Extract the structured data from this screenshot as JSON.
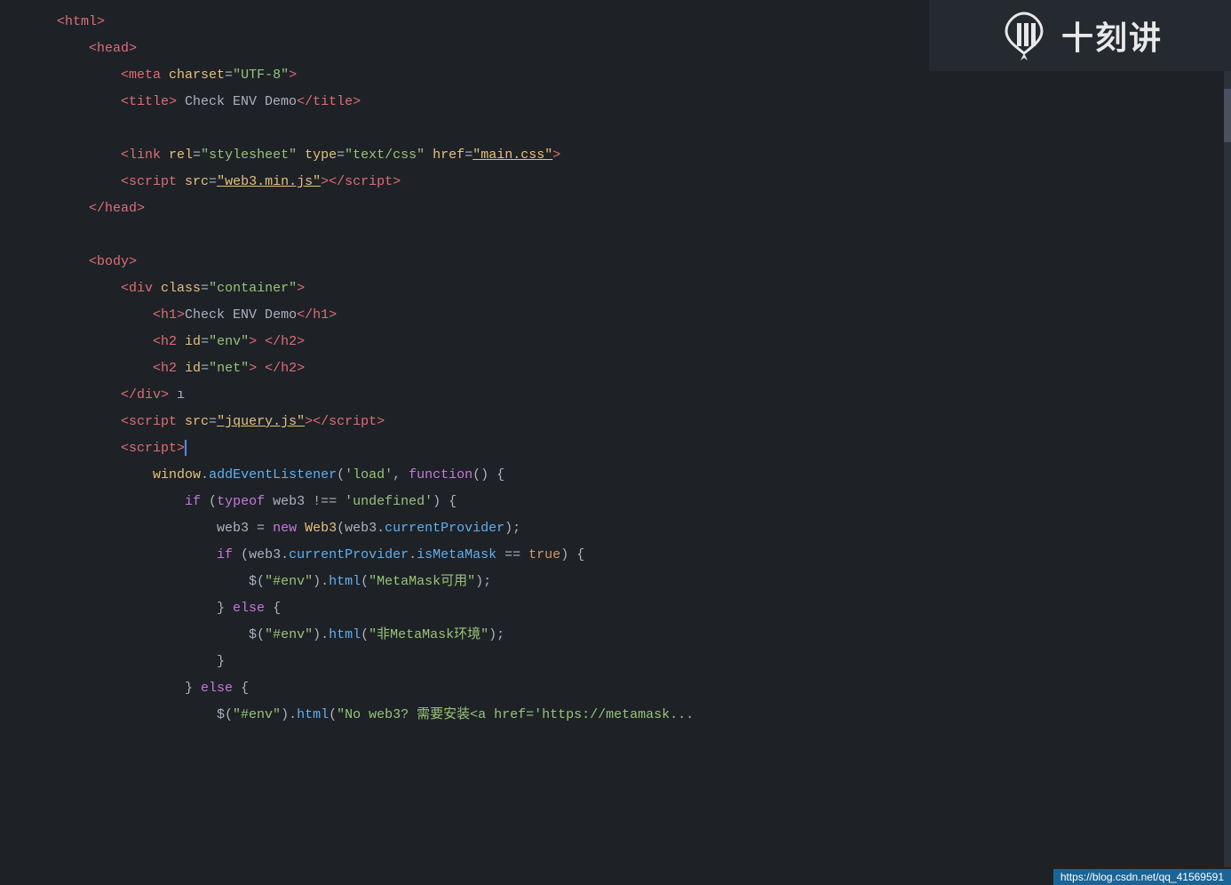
{
  "watermark": {
    "icon_label": "logo-icon",
    "text": "十刻讲"
  },
  "bottom_bar": {
    "url": "https://blog.csdn.net/qq_41569591"
  },
  "lines": [
    {
      "dots": "",
      "indent": 0,
      "parts": [
        {
          "type": "tag",
          "text": "<html>"
        }
      ]
    },
    {
      "dots": "·",
      "indent": 1,
      "parts": [
        {
          "type": "tag",
          "text": "<head>"
        }
      ]
    },
    {
      "dots": "· · ·",
      "indent": 2,
      "parts": [
        {
          "type": "tag",
          "text": "<meta "
        },
        {
          "type": "attr-name",
          "text": "charset"
        },
        {
          "type": "punctuation",
          "text": "="
        },
        {
          "type": "attr-value",
          "text": "\"UTF-8\""
        },
        {
          "type": "tag",
          "text": ">"
        }
      ]
    },
    {
      "dots": "· · ·",
      "indent": 2,
      "parts": [
        {
          "type": "tag",
          "text": "<title>"
        },
        {
          "type": "text-content",
          "text": " Check ENV Demo"
        },
        {
          "type": "tag",
          "text": "</title>"
        }
      ]
    },
    {
      "dots": "",
      "indent": 0,
      "parts": []
    },
    {
      "dots": "· · ·",
      "indent": 2,
      "parts": [
        {
          "type": "tag",
          "text": "<link "
        },
        {
          "type": "attr-name",
          "text": "rel"
        },
        {
          "type": "punctuation",
          "text": "="
        },
        {
          "type": "attr-value",
          "text": "\"stylesheet\""
        },
        {
          "type": "text-content",
          "text": " "
        },
        {
          "type": "attr-name",
          "text": "type"
        },
        {
          "type": "punctuation",
          "text": "="
        },
        {
          "type": "attr-value",
          "text": "\"text/css\""
        },
        {
          "type": "text-content",
          "text": " "
        },
        {
          "type": "attr-name",
          "text": "href"
        },
        {
          "type": "punctuation",
          "text": "="
        },
        {
          "type": "attr-value-link",
          "text": "\"main.css\""
        },
        {
          "type": "tag",
          "text": ">"
        }
      ]
    },
    {
      "dots": "· · ·",
      "indent": 2,
      "parts": [
        {
          "type": "tag",
          "text": "<script "
        },
        {
          "type": "attr-name",
          "text": "src"
        },
        {
          "type": "punctuation",
          "text": "="
        },
        {
          "type": "attr-value-link",
          "text": "\"web3.min.js\""
        },
        {
          "type": "tag",
          "text": "></"
        },
        {
          "type": "tag",
          "text": "script>"
        }
      ]
    },
    {
      "dots": "·",
      "indent": 1,
      "parts": [
        {
          "type": "tag",
          "text": "</head>"
        }
      ]
    },
    {
      "dots": "",
      "indent": 0,
      "parts": []
    },
    {
      "dots": "·",
      "indent": 1,
      "parts": [
        {
          "type": "tag",
          "text": "<body>"
        }
      ]
    },
    {
      "dots": "· · · ·",
      "indent": 2,
      "parts": [
        {
          "type": "tag",
          "text": "<div "
        },
        {
          "type": "attr-name",
          "text": "class"
        },
        {
          "type": "punctuation",
          "text": "="
        },
        {
          "type": "attr-value",
          "text": "\"container\""
        },
        {
          "type": "tag",
          "text": ">"
        }
      ]
    },
    {
      "dots": "· · · · · · ·",
      "indent": 3,
      "parts": [
        {
          "type": "tag",
          "text": "<h1>"
        },
        {
          "type": "text-content",
          "text": "Check ENV Demo"
        },
        {
          "type": "tag",
          "text": "</h1>"
        }
      ]
    },
    {
      "dots": "· · · · · · ·",
      "indent": 3,
      "parts": [
        {
          "type": "tag",
          "text": "<h2 "
        },
        {
          "type": "attr-name",
          "text": "id"
        },
        {
          "type": "punctuation",
          "text": "="
        },
        {
          "type": "attr-value",
          "text": "\"env\""
        },
        {
          "type": "tag",
          "text": "> "
        },
        {
          "type": "tag",
          "text": "</h2>"
        }
      ]
    },
    {
      "dots": "· · · · · · ·",
      "indent": 3,
      "parts": [
        {
          "type": "tag",
          "text": "<h2 "
        },
        {
          "type": "attr-name",
          "text": "id"
        },
        {
          "type": "punctuation",
          "text": "="
        },
        {
          "type": "attr-value",
          "text": "\"net\""
        },
        {
          "type": "tag",
          "text": "> "
        },
        {
          "type": "tag",
          "text": "</h2>"
        }
      ]
    },
    {
      "dots": "· · · ·",
      "indent": 2,
      "parts": [
        {
          "type": "tag",
          "text": "</div>"
        },
        {
          "type": "text-content",
          "text": " ı"
        }
      ]
    },
    {
      "dots": "· · · ·",
      "indent": 2,
      "parts": [
        {
          "type": "tag",
          "text": "<script "
        },
        {
          "type": "attr-name",
          "text": "src"
        },
        {
          "type": "punctuation",
          "text": "="
        },
        {
          "type": "attr-value-link",
          "text": "\"jquery.js\""
        },
        {
          "type": "tag",
          "text": "></"
        },
        {
          "type": "tag",
          "text": "script>"
        }
      ]
    },
    {
      "dots": "· · · ·",
      "indent": 2,
      "parts": [
        {
          "type": "tag",
          "text": "<script>"
        },
        {
          "type": "cursor",
          "text": ""
        }
      ]
    },
    {
      "dots": "· · · · · · · ·",
      "indent": 3,
      "parts": [
        {
          "type": "js-obj",
          "text": "window"
        },
        {
          "type": "punctuation",
          "text": "."
        },
        {
          "type": "js-prop",
          "text": "addEventListener"
        },
        {
          "type": "punctuation",
          "text": "("
        },
        {
          "type": "string",
          "text": "'load'"
        },
        {
          "type": "punctuation",
          "text": ", "
        },
        {
          "type": "keyword",
          "text": "function"
        },
        {
          "type": "punctuation",
          "text": "() {"
        }
      ]
    },
    {
      "dots": "· · · · · · · · · · · ·",
      "indent": 4,
      "parts": [
        {
          "type": "keyword",
          "text": "if"
        },
        {
          "type": "punctuation",
          "text": " ("
        },
        {
          "type": "keyword",
          "text": "typeof"
        },
        {
          "type": "js-text",
          "text": " web3 "
        },
        {
          "type": "punctuation",
          "text": "!== "
        },
        {
          "type": "string",
          "text": "'undefined'"
        },
        {
          "type": "punctuation",
          "text": ") {"
        }
      ]
    },
    {
      "dots": "· · · · · · · · · · · · · · · ·",
      "indent": 5,
      "parts": [
        {
          "type": "js-text",
          "text": "web3 "
        },
        {
          "type": "equals",
          "text": "= "
        },
        {
          "type": "keyword",
          "text": "new "
        },
        {
          "type": "js-obj",
          "text": "Web3"
        },
        {
          "type": "punctuation",
          "text": "("
        },
        {
          "type": "js-text",
          "text": "web3"
        },
        {
          "type": "punctuation",
          "text": "."
        },
        {
          "type": "js-prop",
          "text": "currentProvider"
        },
        {
          "type": "punctuation",
          "text": ");"
        }
      ]
    },
    {
      "dots": "· · · · · · · · · · · ·",
      "indent": 5,
      "parts": [
        {
          "type": "keyword",
          "text": "if"
        },
        {
          "type": "punctuation",
          "text": " ("
        },
        {
          "type": "js-text",
          "text": "web3"
        },
        {
          "type": "punctuation",
          "text": "."
        },
        {
          "type": "js-prop",
          "text": "currentProvider"
        },
        {
          "type": "punctuation",
          "text": "."
        },
        {
          "type": "js-prop",
          "text": "isMetaMask"
        },
        {
          "type": "punctuation",
          "text": " == "
        },
        {
          "type": "js-bool",
          "text": "true"
        },
        {
          "type": "punctuation",
          "text": ") {"
        }
      ]
    },
    {
      "dots": "· · · · · · · · · · · · · · · ·",
      "indent": 6,
      "parts": [
        {
          "type": "js-text",
          "text": "$("
        },
        {
          "type": "string",
          "text": "\"#env\""
        },
        {
          "type": "js-text",
          "text": ")."
        },
        {
          "type": "js-prop",
          "text": "html"
        },
        {
          "type": "punctuation",
          "text": "("
        },
        {
          "type": "string",
          "text": "\"MetaMask可用\""
        },
        {
          "type": "punctuation",
          "text": ");"
        }
      ]
    },
    {
      "dots": "· · · · · · · · · · · ·",
      "indent": 5,
      "parts": [
        {
          "type": "punctuation",
          "text": "} "
        },
        {
          "type": "keyword",
          "text": "else"
        },
        {
          "type": "punctuation",
          "text": " {"
        }
      ]
    },
    {
      "dots": "· · · · · · · · · · · · · · · ·",
      "indent": 6,
      "parts": [
        {
          "type": "js-text",
          "text": "$("
        },
        {
          "type": "string",
          "text": "\"#env\""
        },
        {
          "type": "js-text",
          "text": ")."
        },
        {
          "type": "js-prop",
          "text": "html"
        },
        {
          "type": "punctuation",
          "text": "("
        },
        {
          "type": "string",
          "text": "\"非MetaMask环境\""
        },
        {
          "type": "punctuation",
          "text": ");"
        }
      ]
    },
    {
      "dots": "· · · · · · · · · · · ·",
      "indent": 5,
      "parts": [
        {
          "type": "punctuation",
          "text": "}"
        }
      ]
    },
    {
      "dots": "· · · · · · · ·",
      "indent": 4,
      "parts": [
        {
          "type": "punctuation",
          "text": "} "
        },
        {
          "type": "keyword",
          "text": "else"
        },
        {
          "type": "punctuation",
          "text": " {"
        }
      ]
    },
    {
      "dots": "· · · · · · · · · · · ·",
      "indent": 5,
      "parts": [
        {
          "type": "js-text",
          "text": "$("
        },
        {
          "type": "string",
          "text": "\"#env\""
        },
        {
          "type": "js-text",
          "text": ")."
        },
        {
          "type": "js-prop",
          "text": "html"
        },
        {
          "type": "punctuation",
          "text": "("
        },
        {
          "type": "string",
          "text": "\"No web3? 需要安装<a href='https://metamask..."
        },
        {
          "type": "truncated",
          "text": ""
        }
      ]
    }
  ]
}
